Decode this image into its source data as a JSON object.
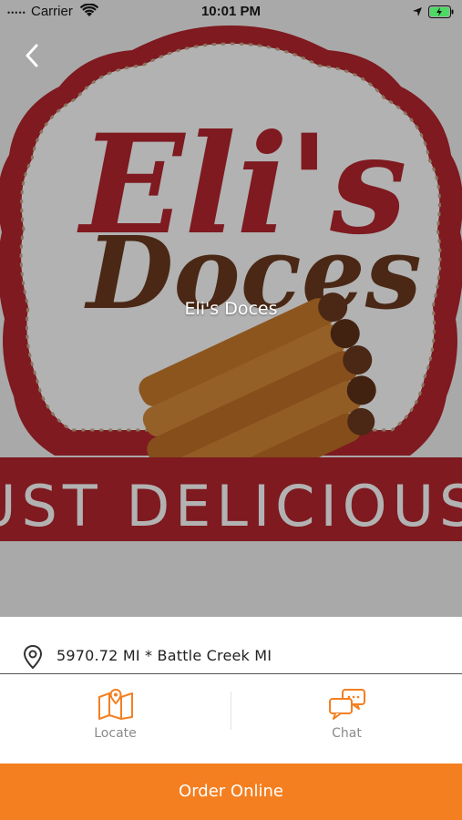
{
  "status_bar": {
    "carrier": "Carrier",
    "time": "10:01 PM",
    "signal_dots": "•••••"
  },
  "hero": {
    "logo_line1": "Eli's",
    "logo_line2": "Doces",
    "banner_text": "JUST DELICIOUS!",
    "overlay_title": "Eli's Doces"
  },
  "location": {
    "distance_text": "5970.72 MI * Battle Creek MI"
  },
  "actions": {
    "locate_label": "Locate",
    "chat_label": "Chat"
  },
  "order_button": {
    "label": "Order Online"
  },
  "colors": {
    "accent": "#f47f20",
    "logo_red": "#b5262f",
    "logo_brown": "#6b3a1f",
    "hero_bg": "#9a9a9a"
  },
  "icons": {
    "back": "chevron-left-icon",
    "location_pin": "map-pin-icon",
    "locate": "map-icon",
    "chat": "chat-bubbles-icon",
    "wifi": "wifi-icon",
    "location_arrow": "location-arrow-icon",
    "battery": "battery-charging-icon"
  }
}
